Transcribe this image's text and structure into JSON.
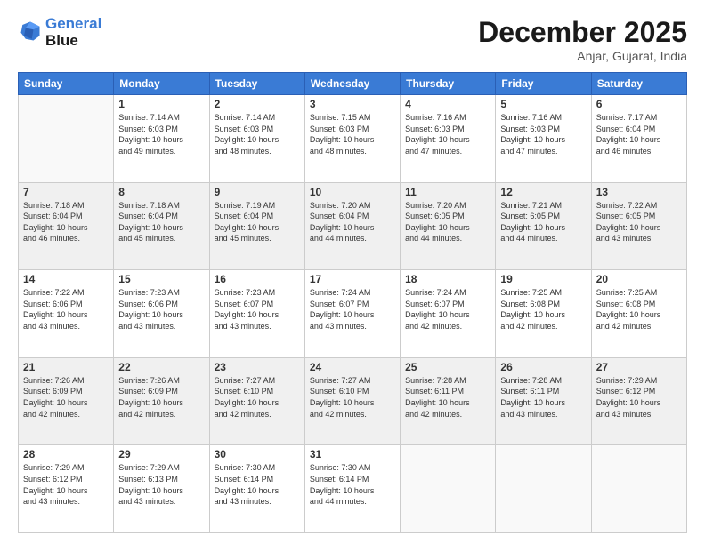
{
  "header": {
    "logo_line1": "General",
    "logo_line2": "Blue",
    "month": "December 2025",
    "location": "Anjar, Gujarat, India"
  },
  "weekdays": [
    "Sunday",
    "Monday",
    "Tuesday",
    "Wednesday",
    "Thursday",
    "Friday",
    "Saturday"
  ],
  "weeks": [
    [
      {
        "day": "",
        "info": ""
      },
      {
        "day": "1",
        "info": "Sunrise: 7:14 AM\nSunset: 6:03 PM\nDaylight: 10 hours\nand 49 minutes."
      },
      {
        "day": "2",
        "info": "Sunrise: 7:14 AM\nSunset: 6:03 PM\nDaylight: 10 hours\nand 48 minutes."
      },
      {
        "day": "3",
        "info": "Sunrise: 7:15 AM\nSunset: 6:03 PM\nDaylight: 10 hours\nand 48 minutes."
      },
      {
        "day": "4",
        "info": "Sunrise: 7:16 AM\nSunset: 6:03 PM\nDaylight: 10 hours\nand 47 minutes."
      },
      {
        "day": "5",
        "info": "Sunrise: 7:16 AM\nSunset: 6:03 PM\nDaylight: 10 hours\nand 47 minutes."
      },
      {
        "day": "6",
        "info": "Sunrise: 7:17 AM\nSunset: 6:04 PM\nDaylight: 10 hours\nand 46 minutes."
      }
    ],
    [
      {
        "day": "7",
        "info": "Sunrise: 7:18 AM\nSunset: 6:04 PM\nDaylight: 10 hours\nand 46 minutes."
      },
      {
        "day": "8",
        "info": "Sunrise: 7:18 AM\nSunset: 6:04 PM\nDaylight: 10 hours\nand 45 minutes."
      },
      {
        "day": "9",
        "info": "Sunrise: 7:19 AM\nSunset: 6:04 PM\nDaylight: 10 hours\nand 45 minutes."
      },
      {
        "day": "10",
        "info": "Sunrise: 7:20 AM\nSunset: 6:04 PM\nDaylight: 10 hours\nand 44 minutes."
      },
      {
        "day": "11",
        "info": "Sunrise: 7:20 AM\nSunset: 6:05 PM\nDaylight: 10 hours\nand 44 minutes."
      },
      {
        "day": "12",
        "info": "Sunrise: 7:21 AM\nSunset: 6:05 PM\nDaylight: 10 hours\nand 44 minutes."
      },
      {
        "day": "13",
        "info": "Sunrise: 7:22 AM\nSunset: 6:05 PM\nDaylight: 10 hours\nand 43 minutes."
      }
    ],
    [
      {
        "day": "14",
        "info": "Sunrise: 7:22 AM\nSunset: 6:06 PM\nDaylight: 10 hours\nand 43 minutes."
      },
      {
        "day": "15",
        "info": "Sunrise: 7:23 AM\nSunset: 6:06 PM\nDaylight: 10 hours\nand 43 minutes."
      },
      {
        "day": "16",
        "info": "Sunrise: 7:23 AM\nSunset: 6:07 PM\nDaylight: 10 hours\nand 43 minutes."
      },
      {
        "day": "17",
        "info": "Sunrise: 7:24 AM\nSunset: 6:07 PM\nDaylight: 10 hours\nand 43 minutes."
      },
      {
        "day": "18",
        "info": "Sunrise: 7:24 AM\nSunset: 6:07 PM\nDaylight: 10 hours\nand 42 minutes."
      },
      {
        "day": "19",
        "info": "Sunrise: 7:25 AM\nSunset: 6:08 PM\nDaylight: 10 hours\nand 42 minutes."
      },
      {
        "day": "20",
        "info": "Sunrise: 7:25 AM\nSunset: 6:08 PM\nDaylight: 10 hours\nand 42 minutes."
      }
    ],
    [
      {
        "day": "21",
        "info": "Sunrise: 7:26 AM\nSunset: 6:09 PM\nDaylight: 10 hours\nand 42 minutes."
      },
      {
        "day": "22",
        "info": "Sunrise: 7:26 AM\nSunset: 6:09 PM\nDaylight: 10 hours\nand 42 minutes."
      },
      {
        "day": "23",
        "info": "Sunrise: 7:27 AM\nSunset: 6:10 PM\nDaylight: 10 hours\nand 42 minutes."
      },
      {
        "day": "24",
        "info": "Sunrise: 7:27 AM\nSunset: 6:10 PM\nDaylight: 10 hours\nand 42 minutes."
      },
      {
        "day": "25",
        "info": "Sunrise: 7:28 AM\nSunset: 6:11 PM\nDaylight: 10 hours\nand 42 minutes."
      },
      {
        "day": "26",
        "info": "Sunrise: 7:28 AM\nSunset: 6:11 PM\nDaylight: 10 hours\nand 43 minutes."
      },
      {
        "day": "27",
        "info": "Sunrise: 7:29 AM\nSunset: 6:12 PM\nDaylight: 10 hours\nand 43 minutes."
      }
    ],
    [
      {
        "day": "28",
        "info": "Sunrise: 7:29 AM\nSunset: 6:12 PM\nDaylight: 10 hours\nand 43 minutes."
      },
      {
        "day": "29",
        "info": "Sunrise: 7:29 AM\nSunset: 6:13 PM\nDaylight: 10 hours\nand 43 minutes."
      },
      {
        "day": "30",
        "info": "Sunrise: 7:30 AM\nSunset: 6:14 PM\nDaylight: 10 hours\nand 43 minutes."
      },
      {
        "day": "31",
        "info": "Sunrise: 7:30 AM\nSunset: 6:14 PM\nDaylight: 10 hours\nand 44 minutes."
      },
      {
        "day": "",
        "info": ""
      },
      {
        "day": "",
        "info": ""
      },
      {
        "day": "",
        "info": ""
      }
    ]
  ]
}
